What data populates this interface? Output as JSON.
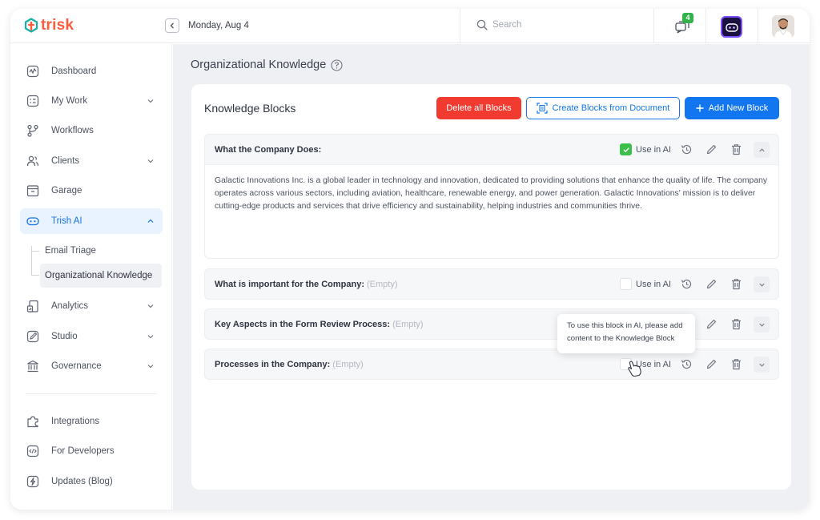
{
  "header": {
    "logo_text": "trisk",
    "date": "Monday, Aug 4",
    "search_placeholder": "Search",
    "chat_badge": "4"
  },
  "sidebar": {
    "items": [
      {
        "label": "Dashboard",
        "icon": "dashboard-icon",
        "chevron": false
      },
      {
        "label": "My Work",
        "icon": "my-work-icon",
        "chevron": true
      },
      {
        "label": "Workflows",
        "icon": "workflows-icon",
        "chevron": false
      },
      {
        "label": "Clients",
        "icon": "clients-icon",
        "chevron": true
      },
      {
        "label": "Garage",
        "icon": "garage-icon",
        "chevron": false
      },
      {
        "label": "Trish AI",
        "icon": "trish-ai-icon",
        "chevron": true,
        "active": true
      },
      {
        "label": "Analytics",
        "icon": "analytics-icon",
        "chevron": true
      },
      {
        "label": "Studio",
        "icon": "studio-icon",
        "chevron": true
      },
      {
        "label": "Governance",
        "icon": "governance-icon",
        "chevron": true
      }
    ],
    "sub_items": [
      {
        "label": "Email Triage"
      },
      {
        "label": "Organizational Knowledge",
        "active": true
      }
    ],
    "bottom_items": [
      {
        "label": "Integrations",
        "icon": "integrations-icon"
      },
      {
        "label": "For Developers",
        "icon": "code-icon"
      },
      {
        "label": "Updates (Blog)",
        "icon": "lightning-icon"
      }
    ]
  },
  "main": {
    "page_title": "Organizational Knowledge",
    "card_title": "Knowledge Blocks",
    "buttons": {
      "delete_all": "Delete all Blocks",
      "create_from_doc": "Create Blocks from Document",
      "add_new": "Add New Block"
    },
    "use_in_ai_label": "Use in AI",
    "blocks": [
      {
        "title": "What the Company Does:",
        "empty_label": "",
        "use_in_ai": true,
        "expanded": true,
        "content": "Galactic Innovations Inc. is a global leader in technology and innovation, dedicated to providing solutions that enhance the quality of life. The company operates across various sectors, including aviation, healthcare, renewable energy, and power generation. Galactic Innovations' mission is to deliver cutting-edge products and services that drive efficiency and sustainability, helping industries and communities thrive."
      },
      {
        "title": "What is important for the Company:",
        "empty_label": "(Empty)",
        "use_in_ai": false,
        "expanded": false
      },
      {
        "title": "Key Aspects in the Form Review Process:",
        "empty_label": "(Empty)",
        "use_in_ai": false,
        "expanded": false
      },
      {
        "title": "Processes in the Company:",
        "empty_label": "(Empty)",
        "use_in_ai": false,
        "expanded": false
      }
    ],
    "tooltip": "To use this block in AI, please add content to the Knowledge Block"
  },
  "colors": {
    "brand": "#ff5a3c",
    "primary": "#1176f0",
    "danger": "#f23b30",
    "success": "#3cbf4a"
  }
}
